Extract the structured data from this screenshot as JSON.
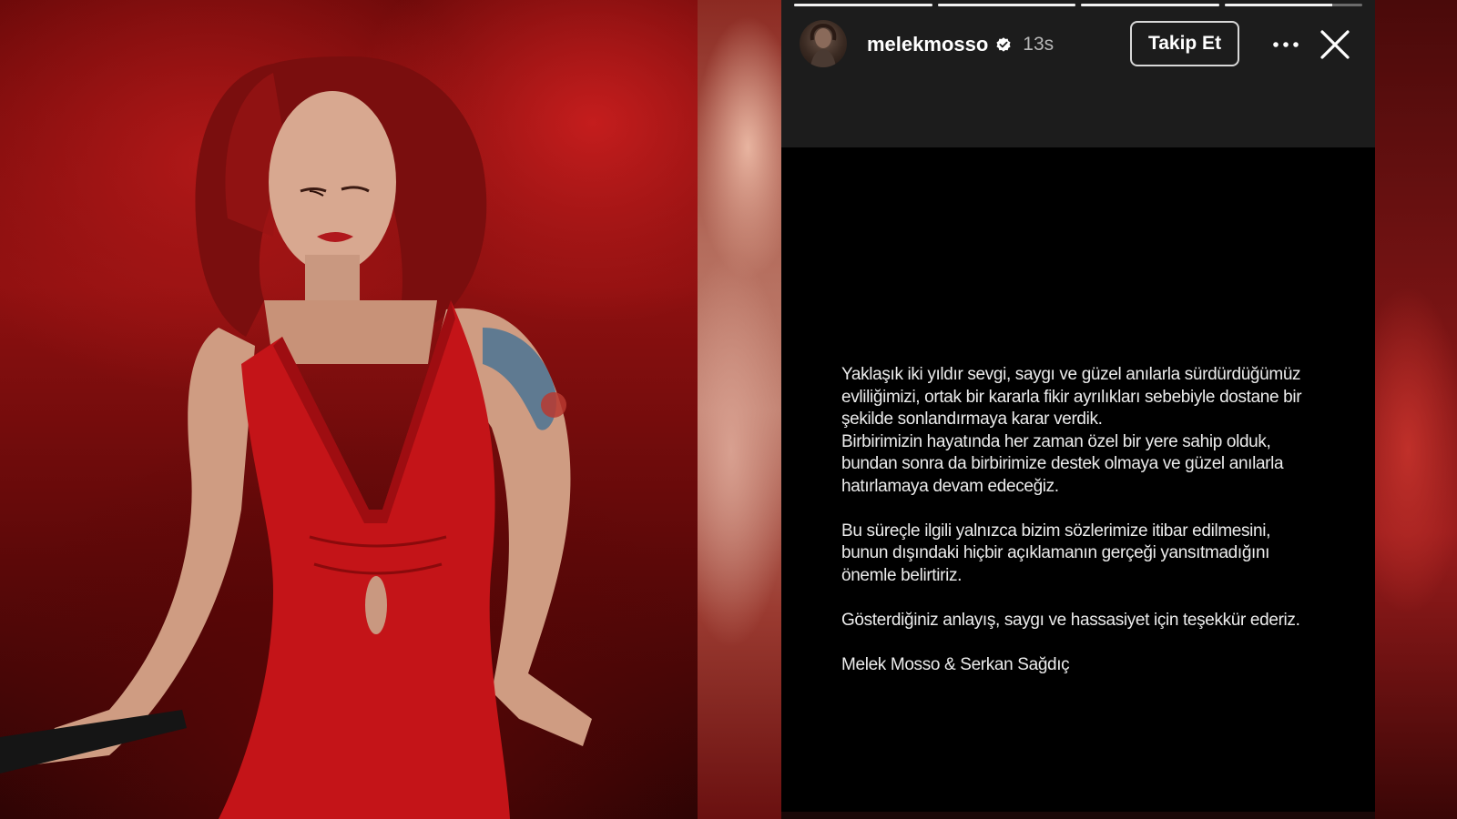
{
  "story": {
    "progress_segments": [
      1.0,
      1.0,
      1.0,
      0.78
    ],
    "username": "melekmosso",
    "verified_icon": "verified-badge-icon",
    "time_ago": "13s",
    "follow_label": "Takip Et",
    "more_icon": "more-options-icon",
    "close_icon": "close-icon",
    "paragraphs": [
      "Yaklaşık iki yıldır sevgi, saygı ve güzel anılarla sürdürdüğümüz\nevliliğimizi, ortak bir kararla fikir ayrılıkları sebebiyle dostane bir\nşekilde sonlandırmaya karar verdik.\nBirbirimizin hayatında her zaman özel bir yere sahip olduk,\nbundan sonra da birbirimize destek olmaya ve güzel anılarla\nhatırlamaya devam edeceğiz.",
      "Bu süreçle ilgili yalnızca bizim sözlerimize itibar edilmesini,\nbunun dışındaki hiçbir açıklamanın gerçeği yansıtmadığını\nönemle belirtiriz.",
      "Gösterdiğiniz anlayış, saygı ve hassasiyet için teşekkür ederiz.",
      "Melek Mosso & Serkan Sağdıç"
    ]
  },
  "colors": {
    "story_background": "#000000",
    "header_background": "#1c1c1c",
    "text": "#ececec",
    "photo_red": "#b01818"
  }
}
